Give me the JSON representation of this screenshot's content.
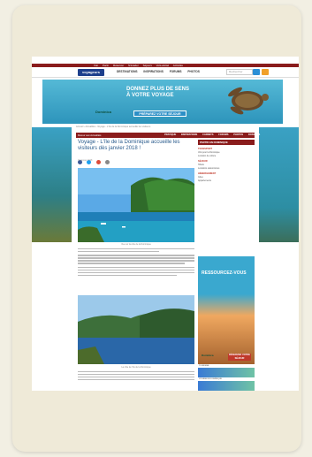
{
  "topbar": {
    "links": [
      "Voir",
      "Partir",
      "Réserver",
      "S'évader",
      "Séjours",
      "Vols+Hôtel",
      "Activités"
    ]
  },
  "header": {
    "logo": "voyageurs",
    "nav": [
      "DESTINATIONS",
      "INSPIRATIONS",
      "FORUMS",
      "PHOTOS"
    ],
    "search_placeholder": "Rechercher"
  },
  "banner": {
    "headline_1": "DONNEZ PLUS DE SENS",
    "headline_2": "À VOTRE VOYAGE",
    "cta": "PRÉPAREZ VOTRE SÉJOUR",
    "brand": "Dominica"
  },
  "breadcrumb": "Accueil › Actualités › Voyage - L'île de la Dominique accueille les visiteurs",
  "category_bar": {
    "home": "Retour aux Actualités",
    "items": [
      "PRATIQUE",
      "INSPIRATIONS",
      "CARNETS",
      "FORUMS",
      "PHOTOS",
      "DOSSIERS"
    ]
  },
  "article": {
    "title": "Voyage - L'île de la Dominique accueille les visiteurs dès janvier 2018 !",
    "date": "15 janvier 2018",
    "caption_1": "Vue sur la côte de la Dominique",
    "caption_2": "La côte de l'île de la Dominique"
  },
  "sidebar": {
    "heading": "PARTIR EN DOMINIQUE",
    "sections": [
      {
        "title": "TRANSPORT",
        "items": [
          "Vols pour la Dominique",
          "Location de voiture"
        ]
      },
      {
        "title": "SÉJOUR",
        "items": [
          "Hôtels",
          "Locations saisonnières"
        ]
      },
      {
        "title": "HÉBERGEMENT",
        "items": [
          "Gîtes",
          "Appartements"
        ]
      }
    ],
    "ad": {
      "title": "RESSOURCEZ-VOUS",
      "cta": "RÉSERVER VOTRE SÉJOUR",
      "brand": "Dominica"
    },
    "thumbs": [
      "TOURISME",
      "VOYAGE EN DOMINIQUE",
      "ACTUALITÉS DE L'ÎLE"
    ]
  },
  "colors": {
    "primary": "#8a1c1c",
    "link": "#2a5b8c",
    "banner": "#2d94bb",
    "accent": "#f0a02a"
  }
}
